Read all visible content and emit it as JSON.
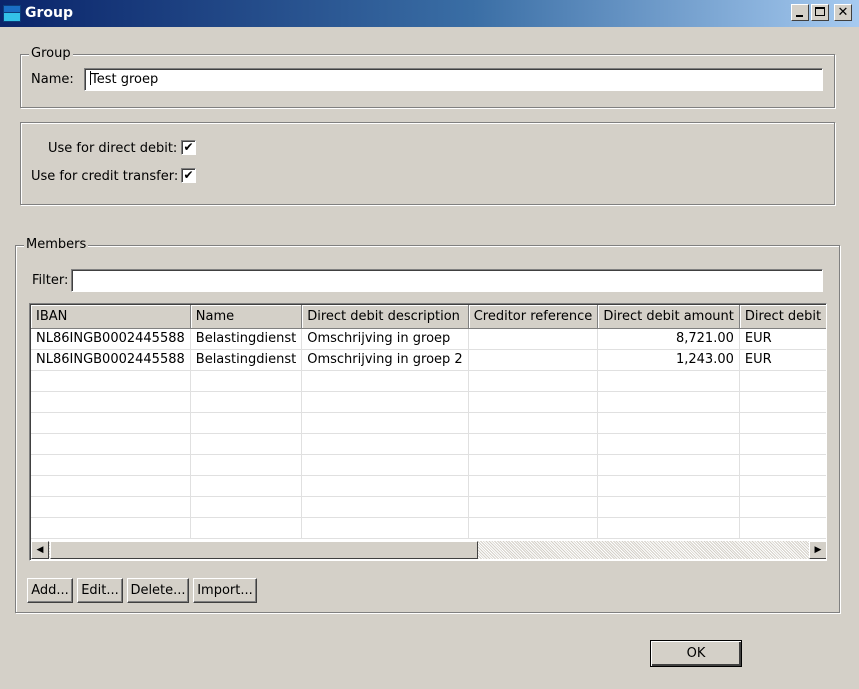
{
  "window": {
    "title": "Group"
  },
  "group_box": {
    "legend": "Group",
    "name_label": "Name:",
    "name_value": "Test groep"
  },
  "options": {
    "direct_debit_label": "Use for direct debit:",
    "direct_debit_checked": true,
    "credit_transfer_label": "Use for credit transfer:",
    "credit_transfer_checked": true,
    "check_glyph": "✔"
  },
  "members": {
    "legend": "Members",
    "filter_label": "Filter:",
    "filter_value": "",
    "columns": [
      "IBAN",
      "Name",
      "Direct debit description",
      "Creditor reference",
      "Direct debit amount",
      "Direct debit currency"
    ],
    "rows": [
      [
        "NL86INGB0002445588",
        "Belastingdienst",
        "Omschrijving in groep",
        "",
        "8,721.00",
        "EUR"
      ],
      [
        "NL86INGB0002445588",
        "Belastingdienst",
        "Omschrijving in groep 2",
        "",
        "1,243.00",
        "EUR"
      ]
    ],
    "empty_rows": 8,
    "scroll_left_glyph": "◀",
    "scroll_right_glyph": "▶",
    "buttons": {
      "add": "Add...",
      "edit": "Edit...",
      "delete": "Delete...",
      "import": "Import..."
    }
  },
  "footer": {
    "ok_label": "OK"
  },
  "titlebar_buttons": {
    "close_glyph": "✕"
  }
}
